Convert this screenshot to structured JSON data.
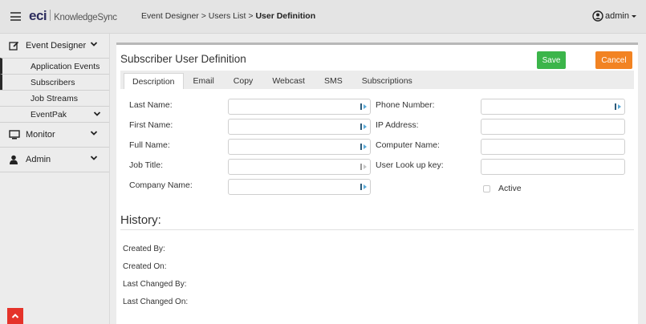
{
  "topbar": {
    "logo_brand": "eci",
    "logo_product": "KnowledgeSync",
    "breadcrumb_1": "Event Designer",
    "breadcrumb_sep_1": ">",
    "breadcrumb_2": "Users List",
    "breadcrumb_sep_2": ">",
    "breadcrumb_current": "User Definition",
    "user_name": "admin"
  },
  "sidebar": {
    "event_designer": "Event Designer",
    "event_designer_items": [
      "Application Events",
      "Subscribers",
      "Job Streams",
      "EventPak"
    ],
    "monitor": "Monitor",
    "admin": "Admin"
  },
  "form": {
    "title": "Subscriber User Definition",
    "save_label": "Save",
    "cancel_label": "Cancel",
    "tabs": [
      "Description",
      "Email",
      "Copy",
      "Webcast",
      "SMS",
      "Subscriptions"
    ],
    "active_tab": "Description",
    "fields_left": [
      "Last Name:",
      "First Name:",
      "Full Name:",
      "Job Title:",
      "Company Name:"
    ],
    "fields_right": [
      "Phone Number:",
      "IP Address:",
      "Computer Name:",
      "User Look up key:"
    ],
    "values": {
      "last_name": "",
      "first_name": "",
      "full_name": "",
      "job_title": "",
      "company_name": "",
      "phone_number": "",
      "ip_address": "",
      "computer_name": "",
      "user_lookup_key": ""
    },
    "active_label": "Active",
    "active_checked": false
  },
  "history": {
    "title": "History:",
    "labels": [
      "Created By:",
      "Created On:",
      "Last Changed By:",
      "Last Changed On:"
    ]
  },
  "colors": {
    "save": "#3bb54a",
    "cancel": "#f28322",
    "scroll_top": "#e5332a",
    "brand": "#2d2d5e"
  },
  "icons": {
    "menu": "hamburger-icon",
    "user": "user-circle-icon",
    "field_lookup": "text-cursor-icon"
  }
}
